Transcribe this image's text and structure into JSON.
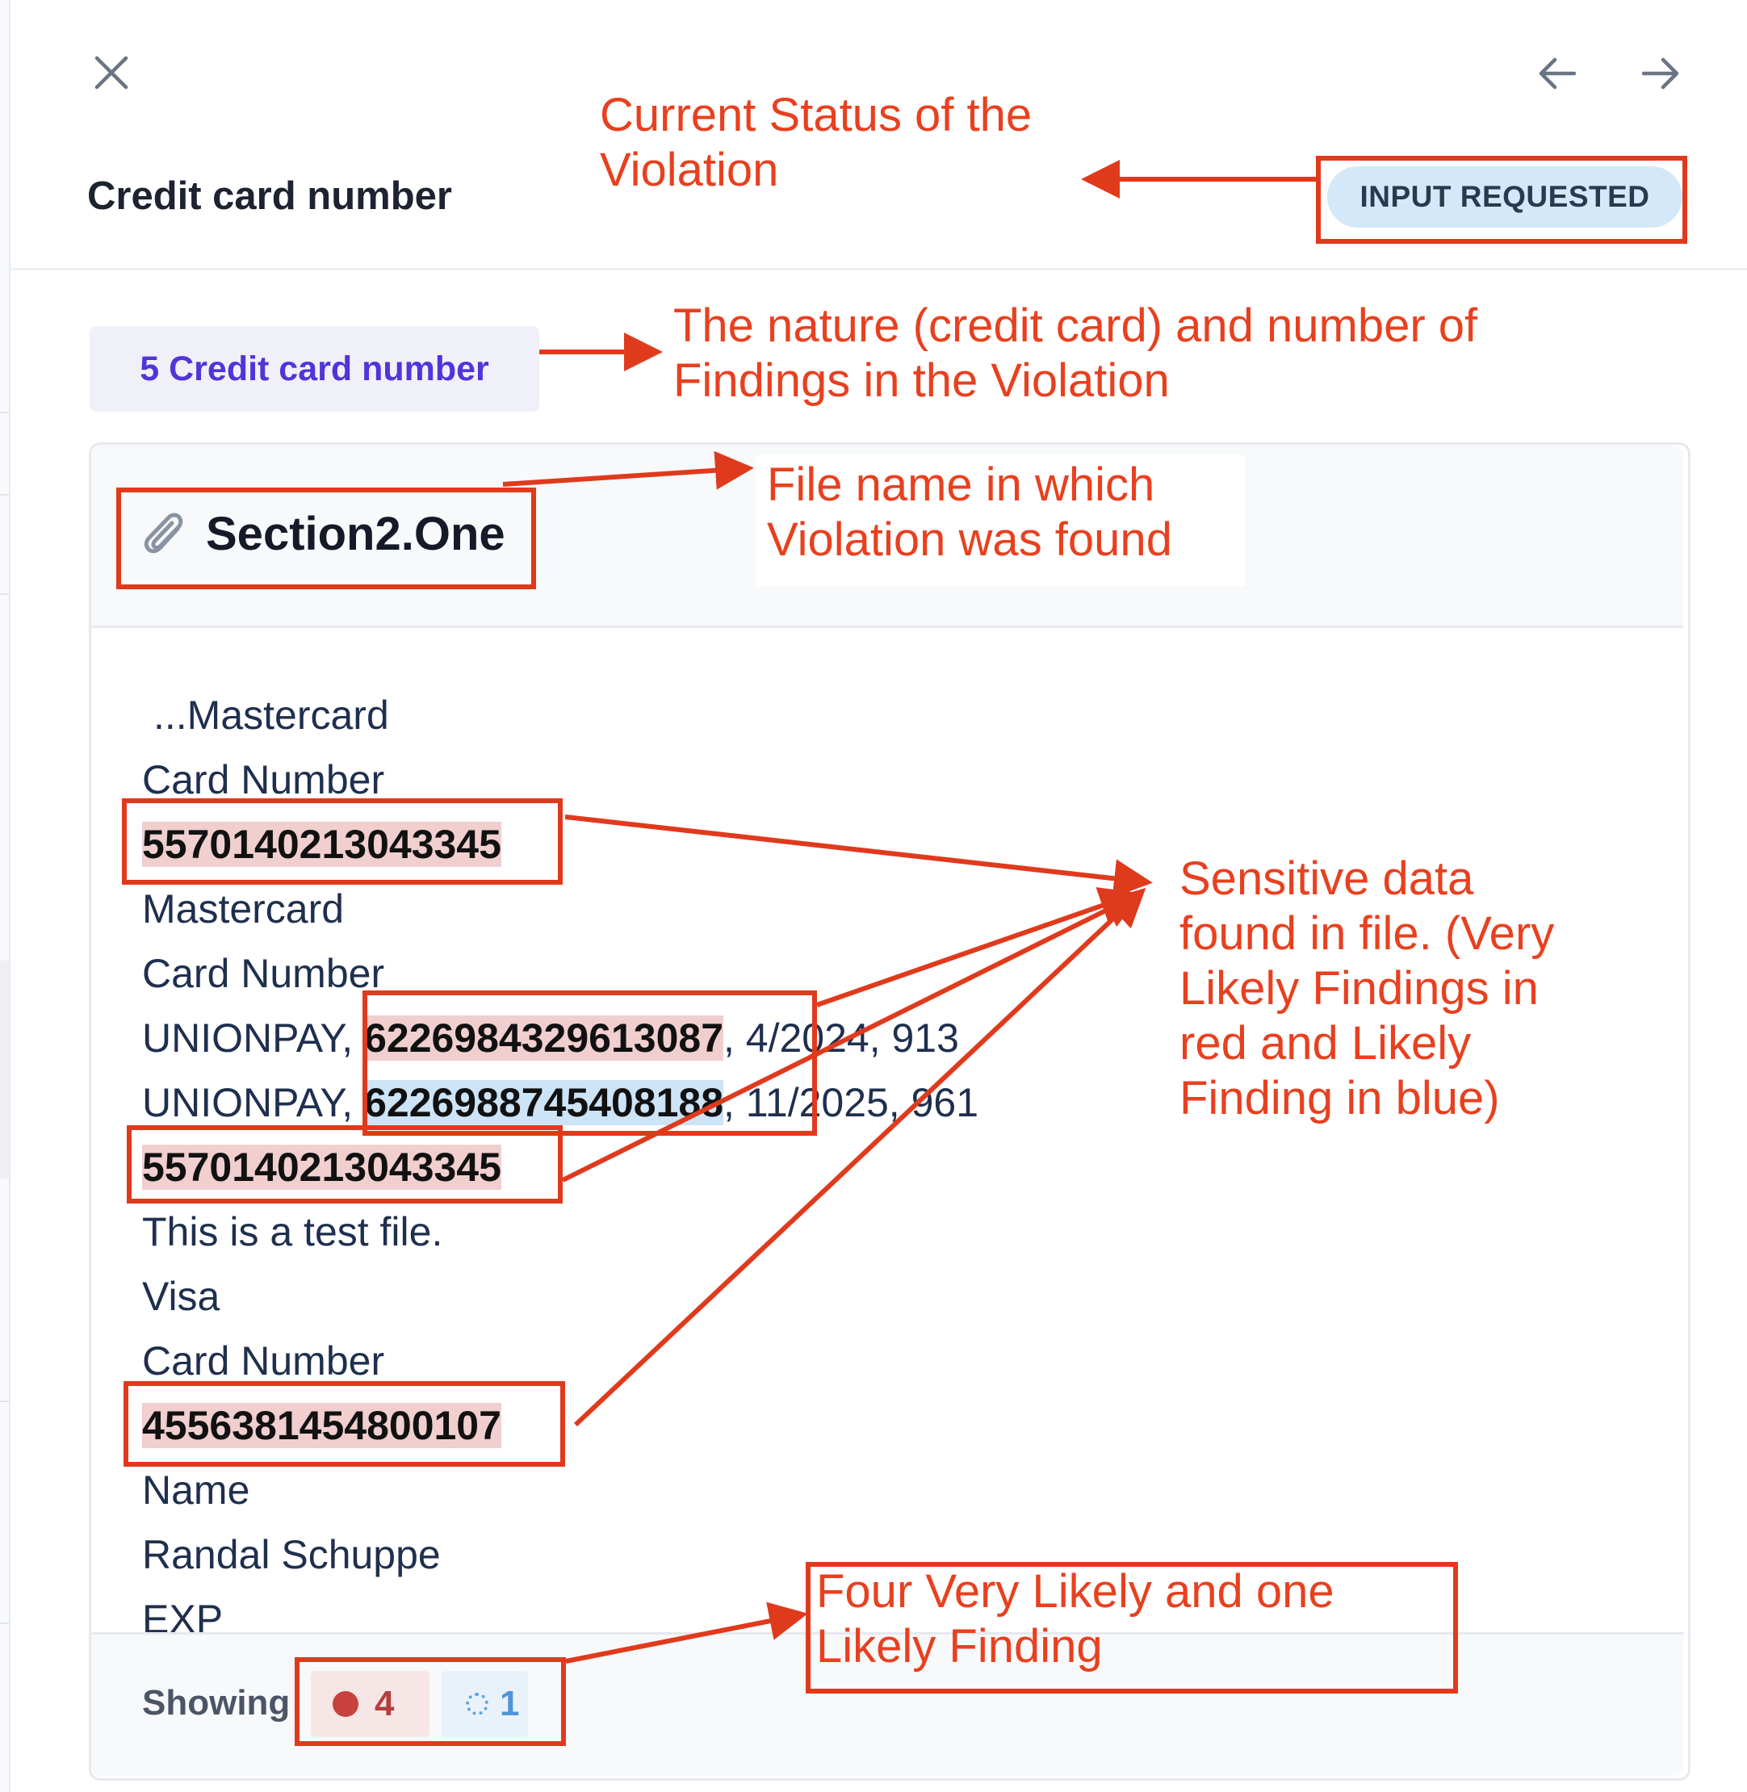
{
  "header": {
    "title": "Credit card number",
    "close_icon": "close-icon",
    "prev_icon": "arrow-left-icon",
    "next_icon": "arrow-right-icon",
    "status": "INPUT REQUESTED"
  },
  "findings_chip": {
    "label": "5 Credit card number"
  },
  "file": {
    "icon": "paperclip-icon",
    "name": "Section2.One"
  },
  "content_lines": [
    {
      "text": "...Mastercard"
    },
    {
      "text": "Card Number"
    },
    {
      "value": "5570140213043345"
    },
    {
      "text": "Mastercard"
    },
    {
      "text": "Card Number"
    },
    {
      "prefix": "UNIONPAY, ",
      "value": "6226984329613087",
      "suffix": ", 4/2024, 913"
    },
    {
      "prefix": "UNIONPAY, ",
      "value": "6226988745408188",
      "suffix": ", 11/2025, 961"
    },
    {
      "value": "5570140213043345"
    },
    {
      "text": "This is a test file."
    },
    {
      "text": "Visa"
    },
    {
      "text": "Card Number"
    },
    {
      "value": "4556381454800107"
    },
    {
      "text": "Name"
    },
    {
      "text": "Randal Schuppe"
    },
    {
      "text": "EXP"
    }
  ],
  "footer": {
    "showing_label": "Showing",
    "very_likely_count": "4",
    "likely_count": "1"
  },
  "annotations": {
    "status": [
      "Current Status of the",
      "Violation"
    ],
    "findings": [
      "The nature (credit card) and number of",
      "Findings in the Violation"
    ],
    "file": [
      "File name in which",
      "Violation was found"
    ],
    "sensitive": [
      "Sensitive data",
      "found in file. (Very",
      "Likely Findings in",
      "red and Likely",
      "Finding in blue)"
    ],
    "counts": [
      "Four Very Likely and one",
      "Likely Finding"
    ]
  },
  "colors": {
    "annotation": "#e8401f",
    "very_likely_highlight": "#f1cfcf",
    "likely_highlight": "#cde3f6",
    "status_badge": "#d3e8f8",
    "chip_text": "#5035d9"
  }
}
